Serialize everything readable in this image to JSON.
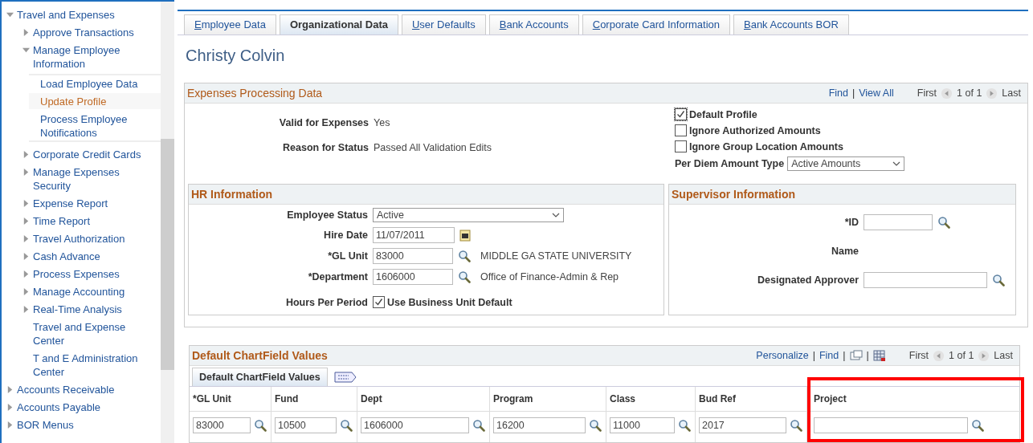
{
  "sidebar": {
    "items": [
      {
        "label": "Travel and Expenses",
        "expanded": true,
        "selected": false,
        "children": [
          {
            "label": "Approve Transactions",
            "expanded": false,
            "selected": false
          },
          {
            "label": "Manage Employee Information",
            "expanded": true,
            "selected": false,
            "children": [
              {
                "label": "Load Employee Data",
                "selected": false
              },
              {
                "label": "Update Profile",
                "selected": true
              },
              {
                "label": "Process Employee Notifications",
                "selected": false
              }
            ]
          },
          {
            "label": "Corporate Credit Cards",
            "expanded": false,
            "selected": false
          },
          {
            "label": "Manage Expenses Security",
            "expanded": false,
            "selected": false
          },
          {
            "label": "Expense Report",
            "expanded": false,
            "selected": false
          },
          {
            "label": "Time Report",
            "expanded": false,
            "selected": false
          },
          {
            "label": "Travel Authorization",
            "expanded": false,
            "selected": false
          },
          {
            "label": "Cash Advance",
            "expanded": false,
            "selected": false
          },
          {
            "label": "Process Expenses",
            "expanded": false,
            "selected": false
          },
          {
            "label": "Manage Accounting",
            "expanded": false,
            "selected": false
          },
          {
            "label": "Real-Time Analysis",
            "expanded": false,
            "selected": false
          },
          {
            "label": "Travel and Expense Center",
            "selected": false
          },
          {
            "label": "T and E Administration Center",
            "selected": false
          }
        ]
      },
      {
        "label": "Accounts Receivable",
        "expanded": false,
        "selected": false
      },
      {
        "label": "Accounts Payable",
        "expanded": false,
        "selected": false
      },
      {
        "label": "BOR Menus",
        "expanded": false,
        "selected": false
      }
    ]
  },
  "tabs": [
    {
      "label": "Employee Data",
      "selected": false
    },
    {
      "label": "Organizational Data",
      "selected": true
    },
    {
      "label": "User Defaults",
      "selected": false
    },
    {
      "label": "Bank Accounts",
      "selected": false
    },
    {
      "label": "Corporate Card Information",
      "selected": false
    },
    {
      "label": "Bank Accounts BOR",
      "selected": false
    }
  ],
  "page_title": "Christy Colvin",
  "expenses_section": {
    "title": "Expenses Processing Data",
    "links": [
      "Find",
      "View All"
    ],
    "separator": "|",
    "nav": {
      "first": "First",
      "count": "1 of 1",
      "last": "Last"
    },
    "fields": [
      {
        "label": "Valid for Expenses",
        "value": "Yes"
      },
      {
        "label": "Reason for Status",
        "value": "Passed All Validation Edits"
      }
    ],
    "checkboxes": [
      {
        "label": "Default Profile",
        "checked": true
      },
      {
        "label": "Ignore Authorized Amounts",
        "checked": false
      },
      {
        "label": "Ignore Group Location Amounts",
        "checked": false
      }
    ],
    "per_diem": {
      "label": "Per Diem Amount Type",
      "value": "Active Amounts"
    }
  },
  "hr_section": {
    "title": "HR Information",
    "fields": [
      {
        "kind": "select",
        "label": "Employee Status",
        "value": "Active"
      },
      {
        "kind": "date",
        "label": "Hire Date",
        "value": "11/07/2011"
      },
      {
        "kind": "lookup",
        "label": "*GL Unit",
        "value": "83000",
        "description": "MIDDLE GA STATE UNIVERSITY"
      },
      {
        "kind": "lookup",
        "label": "*Department",
        "value": "1606000",
        "description": "Office of Finance-Admin & Rep"
      },
      {
        "kind": "checkbox",
        "label": "Hours Per Period",
        "value": "Use Business Unit Default",
        "checked": true
      }
    ]
  },
  "supervisor_section": {
    "title": "Supervisor Information",
    "fields": [
      {
        "kind": "lookup",
        "label": "*ID"
      },
      {
        "kind": "text",
        "label": "Name"
      },
      {
        "kind": "lookup",
        "label": "Designated Approver"
      }
    ]
  },
  "chartfield_section": {
    "title": "Default ChartField Values",
    "links": [
      "Personalize",
      "Find"
    ],
    "separator": "|",
    "nav": {
      "first": "First",
      "count": "1 of 1",
      "last": "Last"
    },
    "tab": "Default ChartField Values",
    "columns": [
      {
        "label": "*GL Unit",
        "value": "83000",
        "highlighted": false
      },
      {
        "label": "Fund",
        "value": "10500",
        "highlighted": false
      },
      {
        "label": "Dept",
        "value": "1606000",
        "highlighted": false
      },
      {
        "label": "Program",
        "value": "16200",
        "highlighted": false
      },
      {
        "label": "Class",
        "value": "11000",
        "highlighted": false
      },
      {
        "label": "Bud Ref",
        "value": "2017",
        "highlighted": false
      },
      {
        "label": "Project",
        "highlighted": true
      }
    ]
  }
}
